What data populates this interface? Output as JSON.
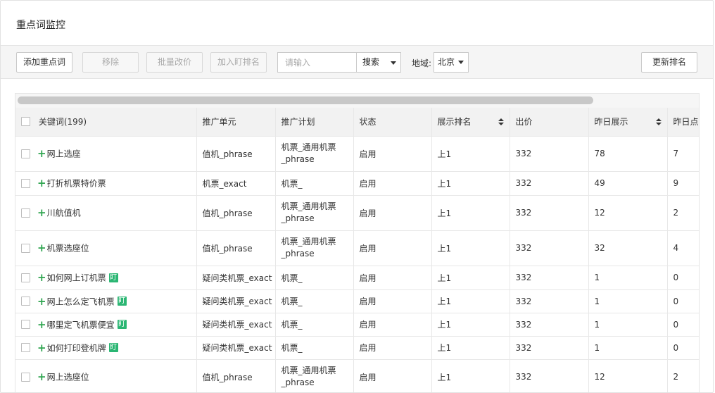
{
  "page": {
    "title": "重点词监控"
  },
  "toolbar": {
    "add_label": "添加重点词",
    "remove_label": "移除",
    "bulk_price_label": "批量改价",
    "add_rank_label": "加入盯排名",
    "search_placeholder": "请输入",
    "search_label": "搜索",
    "region_label": "地域:",
    "region_value": "北京",
    "update_rank_label": "更新排名"
  },
  "table": {
    "headers": {
      "keyword": "关键词(199)",
      "unit": "推广单元",
      "plan": "推广计划",
      "status": "状态",
      "rank": "展示排名",
      "bid": "出价",
      "impressions": "昨日展示",
      "clicks": "昨日点击"
    },
    "rows": [
      {
        "keyword": "网上选座",
        "ding": "",
        "unit": "值机_phrase",
        "plan": "机票_通用机票_phrase",
        "status": "启用",
        "rank": "上1",
        "bid": "332",
        "impressions": "78",
        "clicks": "7"
      },
      {
        "keyword": "打折机票特价票",
        "ding": "",
        "unit": "机票_exact",
        "plan": "机票_",
        "status": "启用",
        "rank": "上1",
        "bid": "332",
        "impressions": "49",
        "clicks": "9"
      },
      {
        "keyword": "川航值机",
        "ding": "",
        "unit": "值机_phrase",
        "plan": "机票_通用机票_phrase",
        "status": "启用",
        "rank": "上1",
        "bid": "332",
        "impressions": "12",
        "clicks": "2"
      },
      {
        "keyword": "机票选座位",
        "ding": "",
        "unit": "值机_phrase",
        "plan": "机票_通用机票_phrase",
        "status": "启用",
        "rank": "上1",
        "bid": "332",
        "impressions": "32",
        "clicks": "4"
      },
      {
        "keyword": "如何网上订机票",
        "ding": "盯",
        "unit": "疑问类机票_exact",
        "plan": "机票_",
        "status": "启用",
        "rank": "上1",
        "bid": "332",
        "impressions": "1",
        "clicks": "0"
      },
      {
        "keyword": "网上怎么定飞机票",
        "ding": "盯",
        "unit": "疑问类机票_exact",
        "plan": "机票_",
        "status": "启用",
        "rank": "上1",
        "bid": "332",
        "impressions": "1",
        "clicks": "0"
      },
      {
        "keyword": "哪里定飞机票便宜",
        "ding": "盯",
        "unit": "疑问类机票_exact",
        "plan": "机票_",
        "status": "启用",
        "rank": "上1",
        "bid": "332",
        "impressions": "1",
        "clicks": "0"
      },
      {
        "keyword": "如何打印登机牌",
        "ding": "盯",
        "unit": "疑问类机票_exact",
        "plan": "机票_",
        "status": "启用",
        "rank": "上1",
        "bid": "332",
        "impressions": "1",
        "clicks": "0"
      },
      {
        "keyword": "网上选座位",
        "ding": "",
        "unit": "值机_phrase",
        "plan": "机票_通用机票_phrase",
        "status": "启用",
        "rank": "上1",
        "bid": "332",
        "impressions": "12",
        "clicks": "2"
      }
    ]
  }
}
